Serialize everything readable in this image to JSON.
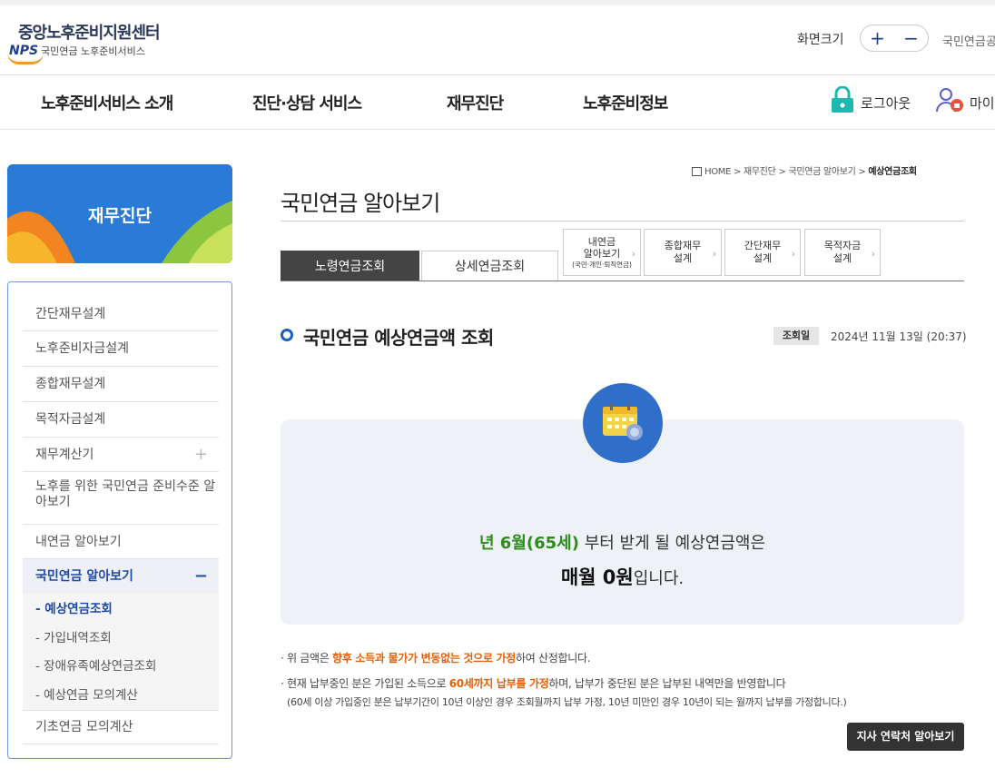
{
  "header": {
    "logo_title": "중앙노후준비지원센터",
    "logo_nps": "NPS",
    "logo_sub": "국민연금 노후준비서비스",
    "fontsize_label": "화면크기",
    "zoom_in": "+",
    "zoom_out": "−",
    "right_text": "국민연금공단"
  },
  "gnb": {
    "items": [
      "노후준비서비스 소개",
      "진단·상담 서비스",
      "재무진단",
      "노후준비정보"
    ],
    "logout": "로그아웃",
    "mypage": "마이페이지"
  },
  "sidebar": {
    "banner_title": "재무진단",
    "items": [
      "간단재무설계",
      "노후준비자금설계",
      "종합재무설계",
      "목적자금설계",
      "재무계산기",
      "노후를 위한 국민연금 준비수준 알아보기",
      "내연금 알아보기",
      "국민연금 알아보기",
      "기초연금 모의계산"
    ],
    "expand_plus": "+",
    "collapse_minus": "−",
    "subitems": [
      "- 예상연금조회",
      "- 가입내역조회",
      "- 장애유족예상연금조회",
      "- 예상연금 모의계산"
    ]
  },
  "breadcrumb": {
    "home": "HOME",
    "sep": " > ",
    "crumbs": [
      "재무진단",
      "국민연금 알아보기"
    ],
    "current": "예상연금조회"
  },
  "page": {
    "title": "국민연금 알아보기",
    "tabs": [
      "노령연금조회",
      "상세연금조회"
    ],
    "small_tabs": [
      {
        "l1": "내연금",
        "l2": "알아보기",
        "l3": "(국민·개인·퇴직연금)"
      },
      {
        "l1": "종합재무",
        "l2": "설계"
      },
      {
        "l1": "간단재무",
        "l2": "설계"
      },
      {
        "l1": "목적자금",
        "l2": "설계"
      }
    ],
    "section_title": "국민연금 예상연금액 조회",
    "date_label": "조회일",
    "date_value": "2024년 11월 13일 (20:37)"
  },
  "result": {
    "highlight": "년 6월(65세)",
    "line1_rest": " 부터 받게 될 예상연금액은",
    "amount": "매월 0원",
    "suffix": "입니다."
  },
  "notes": {
    "n1_a": "· 위 금액은 ",
    "n1_b": "향후 소득과 물가가 변동없는 것으로 가정",
    "n1_c": "하여 산정합니다.",
    "n2_a": "· 현재 납부중인 분은 가입된 소득으로 ",
    "n2_b": "60세까지 납부를 가정",
    "n2_c": "하며, 납부가 중단된 분은 납부된 내역만을 반영합니다",
    "n3": "(60세 이상 가입중인 분은 납부기간이 10년 이상인 경우 조회월까지 납부 가정, 10년 미만인 경우 10년이 되는 월까지 납부를 가정합니다.)"
  },
  "branch_button": "지사 연락처 알아보기",
  "colors": {
    "accent": "#1f5fbf",
    "green": "#2e8b1e",
    "orange": "#e0600b",
    "banner": "#2a7bd5"
  }
}
